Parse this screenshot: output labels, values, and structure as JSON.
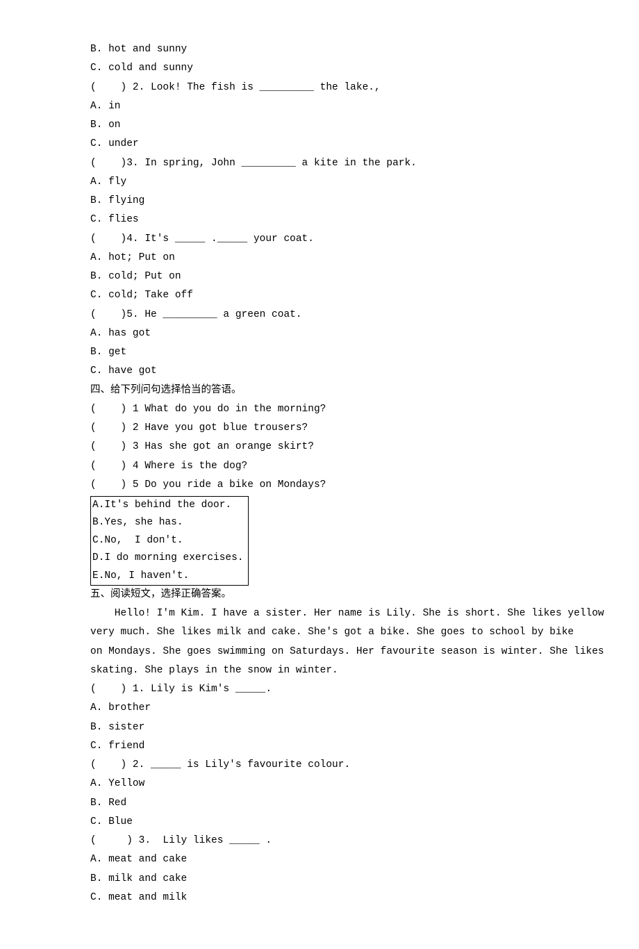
{
  "q1_opt_b": "B. hot and sunny",
  "q1_opt_c": "C. cold and sunny",
  "q2_line": "(    ) 2. Look! The fish is _________ the lake.,",
  "q2_opt_a": "A. in",
  "q2_opt_b": "B. on",
  "q2_opt_c": "C. under",
  "q3_line": "(    )3. In spring, John _________ a kite in the park.",
  "q3_opt_a": "A. fly",
  "q3_opt_b": "B. flying",
  "q3_opt_c": "C. flies",
  "q4_line": "(    )4. It's _____ ._____ your coat.",
  "q4_opt_a": "A. hot; Put on",
  "q4_opt_b": "B. cold; Put on",
  "q4_opt_c": "C. cold; Take off",
  "q5_line": "(    )5. He _________ a green coat.",
  "q5_opt_a": "A. has got",
  "q5_opt_b": "B. get",
  "q5_opt_c": "C. have got",
  "section4_title": "四、给下列问句选择恰当的答语。",
  "s4_q1": "(    ) 1 What do you do in the morning?",
  "s4_q2": "(    ) 2 Have you got blue trousers?",
  "s4_q3": "(    ) 3 Has she got an orange skirt?",
  "s4_q4": "(    ) 4 Where is the dog?",
  "s4_q5": "(    ) 5 Do you ride a bike on Mondays?",
  "box_a": "A.It's behind the door.",
  "box_b": "B.Yes, she has.",
  "box_c": "C.No,  I don't.",
  "box_d": "D.I do morning exercises.",
  "box_e": "E.No, I haven't.",
  "section5_title": "五、阅读短文，选择正确答案。",
  "passage_l1": "    Hello! I'm Kim. I have a sister. Her name is Lily. She is short. She likes yellow",
  "passage_l2": "very much. She likes milk and cake. She's got a bike. She goes to school by bike",
  "passage_l3": "on Mondays. She goes swimming on Saturdays. Her favourite season is winter. She likes",
  "passage_l4": "skating. She plays in the snow in winter.",
  "s5_q1": "(    ) 1. Lily is Kim's _____.",
  "s5_q1_a": "A. brother",
  "s5_q1_b": "B. sister",
  "s5_q1_c": "C. friend",
  "s5_q2": "(    ) 2. _____ is Lily's favourite colour.",
  "s5_q2_a": "A. Yellow",
  "s5_q2_b": "B. Red",
  "s5_q2_c": "C. Blue",
  "s5_q3": "(     ) 3.  Lily likes _____ .",
  "s5_q3_a": "A. meat and cake",
  "s5_q3_b": "B. milk and cake",
  "s5_q3_c": "C. meat and milk"
}
